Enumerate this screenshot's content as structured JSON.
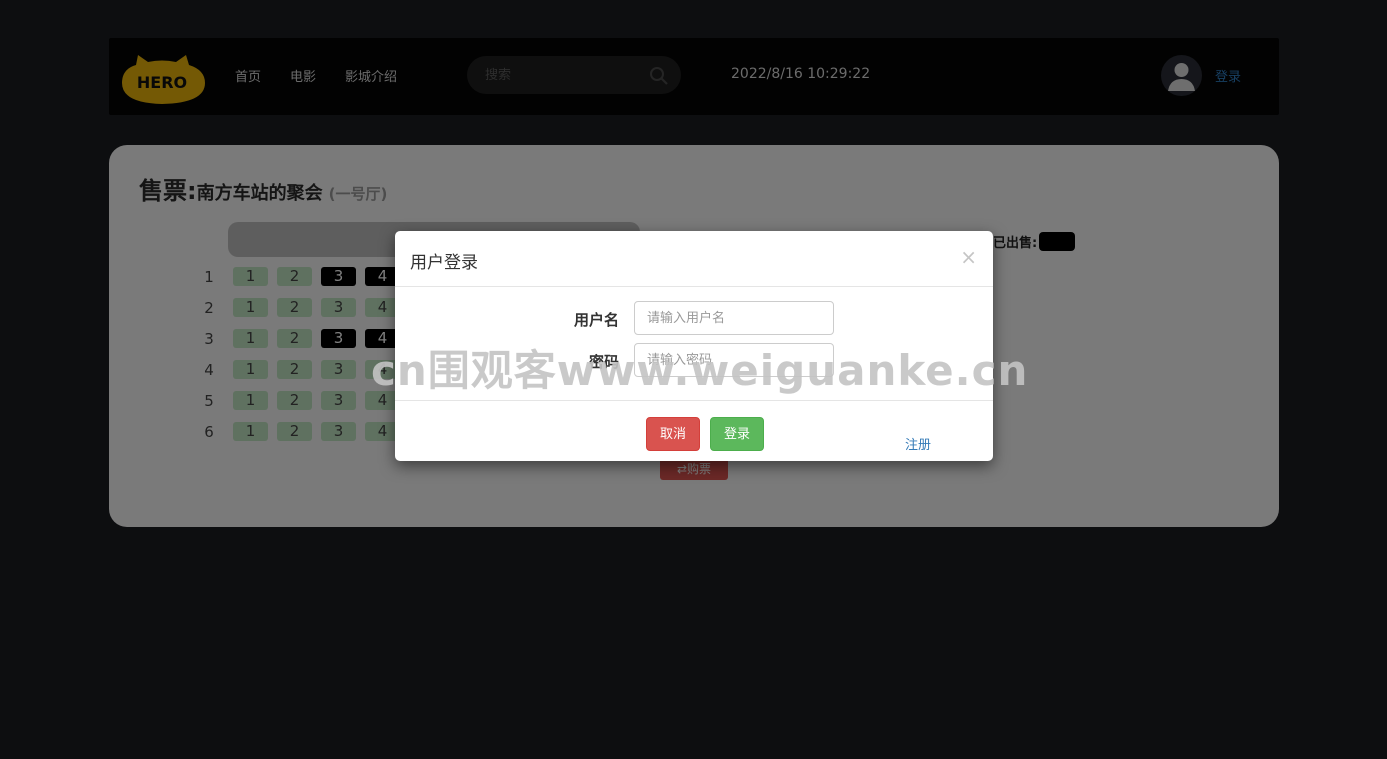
{
  "header": {
    "logo_text": "HERO",
    "nav": [
      {
        "label": "首页"
      },
      {
        "label": "电影"
      },
      {
        "label": "影城介绍"
      }
    ],
    "search": {
      "placeholder": "搜索"
    },
    "datetime": "2022/8/16 10:29:22",
    "login_label": "登录"
  },
  "ticket": {
    "title_prefix": "售票:",
    "movie": "南方车站的聚会",
    "hall": "(一号厅)",
    "legend_sold": "已出售:",
    "rows": [
      {
        "label": "1",
        "seats": [
          {
            "n": "1",
            "sold": false
          },
          {
            "n": "2",
            "sold": false
          },
          {
            "n": "3",
            "sold": true
          },
          {
            "n": "4",
            "sold": true
          }
        ]
      },
      {
        "label": "2",
        "seats": [
          {
            "n": "1",
            "sold": false
          },
          {
            "n": "2",
            "sold": false
          },
          {
            "n": "3",
            "sold": false
          },
          {
            "n": "4",
            "sold": false
          }
        ]
      },
      {
        "label": "3",
        "seats": [
          {
            "n": "1",
            "sold": false
          },
          {
            "n": "2",
            "sold": false
          },
          {
            "n": "3",
            "sold": true
          },
          {
            "n": "4",
            "sold": true
          }
        ]
      },
      {
        "label": "4",
        "seats": [
          {
            "n": "1",
            "sold": false
          },
          {
            "n": "2",
            "sold": false
          },
          {
            "n": "3",
            "sold": false
          },
          {
            "n": "4",
            "sold": false
          }
        ]
      },
      {
        "label": "5",
        "seats": [
          {
            "n": "1",
            "sold": false
          },
          {
            "n": "2",
            "sold": false
          },
          {
            "n": "3",
            "sold": false
          },
          {
            "n": "4",
            "sold": false
          }
        ]
      },
      {
        "label": "6",
        "seats": [
          {
            "n": "1",
            "sold": false
          },
          {
            "n": "2",
            "sold": false
          },
          {
            "n": "3",
            "sold": false
          },
          {
            "n": "4",
            "sold": false
          }
        ]
      }
    ],
    "buy_label": "⇄购票"
  },
  "modal": {
    "title": "用户登录",
    "close": "×",
    "username_label": "用户名",
    "username_placeholder": "请输入用户名",
    "password_label": "密码",
    "password_placeholder": "请输入密码",
    "cancel_label": "取消",
    "login_label": "登录",
    "register_label": "注册"
  },
  "watermark": "cn围观客www.weiguanke.cn",
  "colors": {
    "seat_available": "#bfe3c0",
    "seat_sold": "#000000",
    "danger": "#d9534f",
    "success": "#5cb85c",
    "link": "#337ab7",
    "logo": "#e8b30a"
  }
}
